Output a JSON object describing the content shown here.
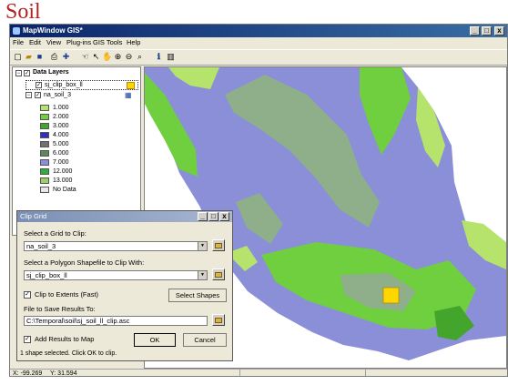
{
  "heading": "Soil",
  "window": {
    "title": "MapWindow GIS*",
    "controls": {
      "minimize": "_",
      "maximize": "□",
      "close": "x"
    }
  },
  "menu": [
    "File",
    "Edit",
    "View",
    "Plug-ins",
    "GIS Tools",
    "Help"
  ],
  "toolbar_icons": [
    "new-icon",
    "open-icon",
    "save-icon",
    "print-icon",
    "add-layer-icon",
    "pan-icon",
    "select-icon",
    "identify-icon",
    "zoom-in-icon",
    "zoom-out-icon",
    "zoom-extent-icon",
    "info-icon",
    "layout-icon"
  ],
  "legend": {
    "group": "Data Layers",
    "layers": [
      {
        "name": "sj_clip_box_ll",
        "swatch": "#ffd700"
      },
      {
        "name": "na_soil_3"
      }
    ],
    "classes": [
      {
        "label": "1.000",
        "color": "#b6e36c"
      },
      {
        "label": "2.000",
        "color": "#6fcf3f"
      },
      {
        "label": "3.000",
        "color": "#43a52b"
      },
      {
        "label": "4.000",
        "color": "#3030c0"
      },
      {
        "label": "5.000",
        "color": "#707070"
      },
      {
        "label": "6.000",
        "color": "#5a8a5a"
      },
      {
        "label": "7.000",
        "color": "#8a8fd8"
      },
      {
        "label": "12.000",
        "color": "#2fae3a"
      },
      {
        "label": "13.000",
        "color": "#9ad06a"
      },
      {
        "label": "No Data",
        "color": "#e8e8e8"
      }
    ]
  },
  "dialog": {
    "title": "Clip Grid",
    "grid_label": "Select a Grid to Clip:",
    "grid_value": "na_soil_3",
    "shapefile_label": "Select a Polygon Shapefile to Clip With:",
    "shapefile_value": "sj_clip_box_ll",
    "clip_extents_label": "Clip to Extents (Fast)",
    "select_shapes_button": "Select Shapes",
    "file_label": "File to Save Results To:",
    "file_value": "C:\\Temporal\\soil\\sj_soil_ll_clip.asc",
    "add_results_label": "Add Results to Map",
    "ok_button": "OK",
    "cancel_button": "Cancel",
    "status": "1 shape selected. Click OK to clip."
  },
  "statusbar": {
    "x_label": "X: -99.269",
    "y_label": "Y: 31.594"
  },
  "colors": {
    "soil_purple": "#8a8fd8",
    "soil_green": "#6fcf3f",
    "soil_lime": "#b6e36c",
    "soil_gray": "#8fae8a",
    "clip_box": "#ffd700"
  }
}
